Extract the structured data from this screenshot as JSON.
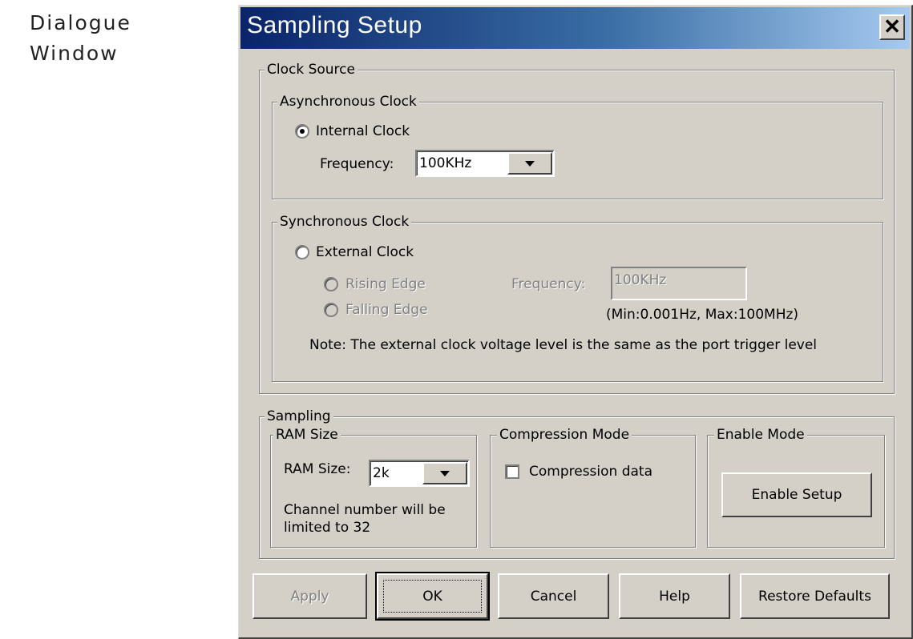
{
  "caption": {
    "line1": "Dialogue",
    "line2": "Window"
  },
  "window": {
    "title": "Sampling Setup",
    "close_glyph": "✕"
  },
  "clock_source": {
    "legend": "Clock Source",
    "async": {
      "legend": "Asynchronous Clock",
      "internal_label": "Internal Clock",
      "internal_selected": true,
      "frequency_label": "Frequency:",
      "frequency_value": "100KHz"
    },
    "sync": {
      "legend": "Synchronous Clock",
      "external_label": "External Clock",
      "external_selected": false,
      "rising_label": "Rising Edge",
      "falling_label": "Falling Edge",
      "frequency_label": "Frequency:",
      "frequency_value": "100KHz",
      "range_note": "(Min:0.001Hz, Max:100MHz)",
      "note": "Note: The external clock voltage level is the same as the port trigger level"
    }
  },
  "sampling": {
    "legend": "Sampling",
    "ram": {
      "legend": "RAM Size",
      "label": "RAM Size:",
      "value": "2k",
      "note_line1": "Channel number will be",
      "note_line2": "limited to 32"
    },
    "compression": {
      "legend": "Compression Mode",
      "checkbox_label": "Compression data",
      "checked": false
    },
    "enable": {
      "legend": "Enable Mode",
      "button_label": "Enable Setup"
    }
  },
  "buttons": {
    "apply": "Apply",
    "ok": "OK",
    "cancel": "Cancel",
    "help": "Help",
    "restore": "Restore Defaults"
  },
  "colors": {
    "dialog_face": "#d4d0c8",
    "title_gradient_start": "#0a246a",
    "title_gradient_end": "#a6caf0",
    "disabled_text": "#808080"
  }
}
